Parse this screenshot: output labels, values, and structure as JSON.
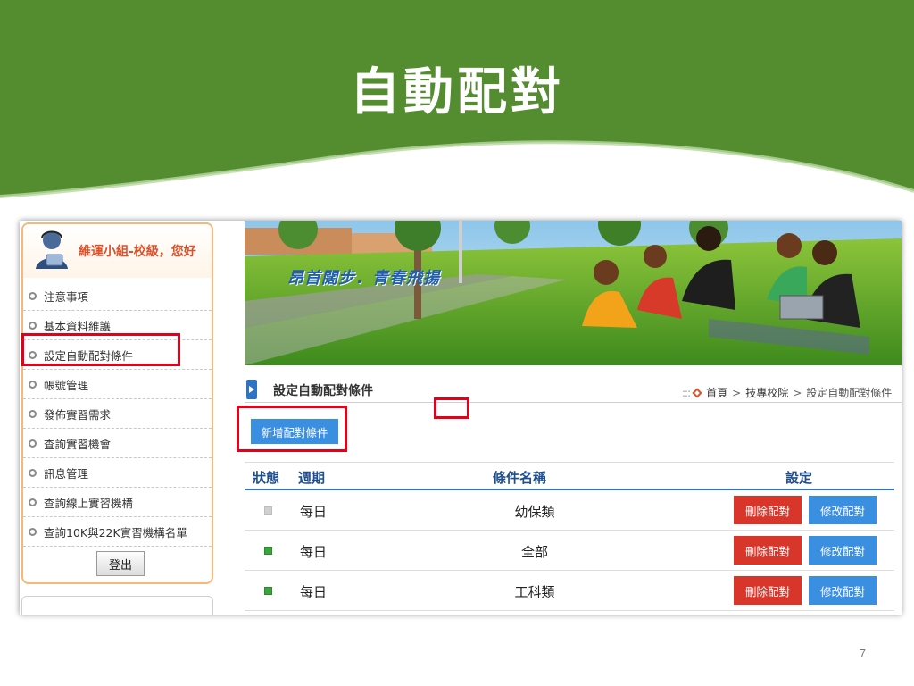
{
  "slide": {
    "title": "自動配對",
    "page_number": "7",
    "header_color": "#548c30"
  },
  "sidebar": {
    "user_name": "維運小組-校級，您好",
    "items": [
      {
        "label": "注意事項"
      },
      {
        "label": "基本資料維護"
      },
      {
        "label": "設定自動配對條件"
      },
      {
        "label": "帳號管理"
      },
      {
        "label": "發佈實習需求"
      },
      {
        "label": "查詢實習機會"
      },
      {
        "label": "訊息管理"
      },
      {
        "label": "查詢線上實習機構"
      },
      {
        "label": "查詢10K與22K實習機構名單"
      }
    ],
    "logout_label": "登出"
  },
  "banner": {
    "slogan": "昂首闊步．青春飛揚"
  },
  "section": {
    "title": "設定自動配對條件",
    "breadcrumb": {
      "home": "首頁",
      "level2": "技專校院",
      "current": "設定自動配對條件"
    }
  },
  "toolbar": {
    "add_label": "新增配對條件"
  },
  "table": {
    "headers": {
      "status": "狀態",
      "period": "週期",
      "name": "條件名稱",
      "settings": "設定"
    },
    "rows": [
      {
        "status": "inactive",
        "period": "每日",
        "name": "幼保類",
        "delete_label": "刪除配對",
        "edit_label": "修改配對"
      },
      {
        "status": "active",
        "period": "每日",
        "name": "全部",
        "delete_label": "刪除配對",
        "edit_label": "修改配對"
      },
      {
        "status": "active",
        "period": "每日",
        "name": "工科類",
        "delete_label": "刪除配對",
        "edit_label": "修改配對"
      }
    ]
  },
  "colors": {
    "highlight": "#e5001a",
    "delete_button": "#d9362b",
    "edit_button": "#3b8fe0",
    "status_active": "#3aa53a",
    "status_inactive": "#d0d0d0"
  }
}
